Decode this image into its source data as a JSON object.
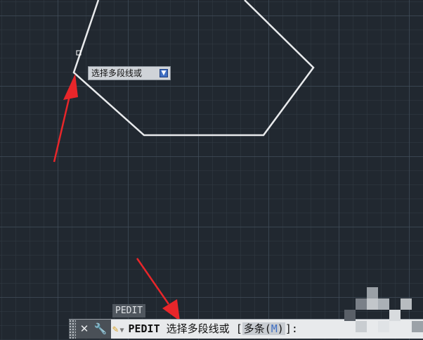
{
  "tooltip": {
    "text": "选择多段线或",
    "icon": "download-arrow-icon"
  },
  "command_tag": {
    "label": "PEDIT"
  },
  "command_line": {
    "command": "PEDIT",
    "prompt": "选择多段线或",
    "open_bracket": "[",
    "option_text": "多条(",
    "option_key": "M",
    "option_close": ")",
    "close_bracket": "]:"
  },
  "icons": {
    "close": "close-icon",
    "settings": "wrench-icon",
    "history": "pencil-icon",
    "dropdown": "chevron-down-icon"
  },
  "colors": {
    "background": "#212830",
    "polyline": "#e8eaec",
    "arrow": "#e8262a",
    "accent": "#3f6fc4"
  }
}
